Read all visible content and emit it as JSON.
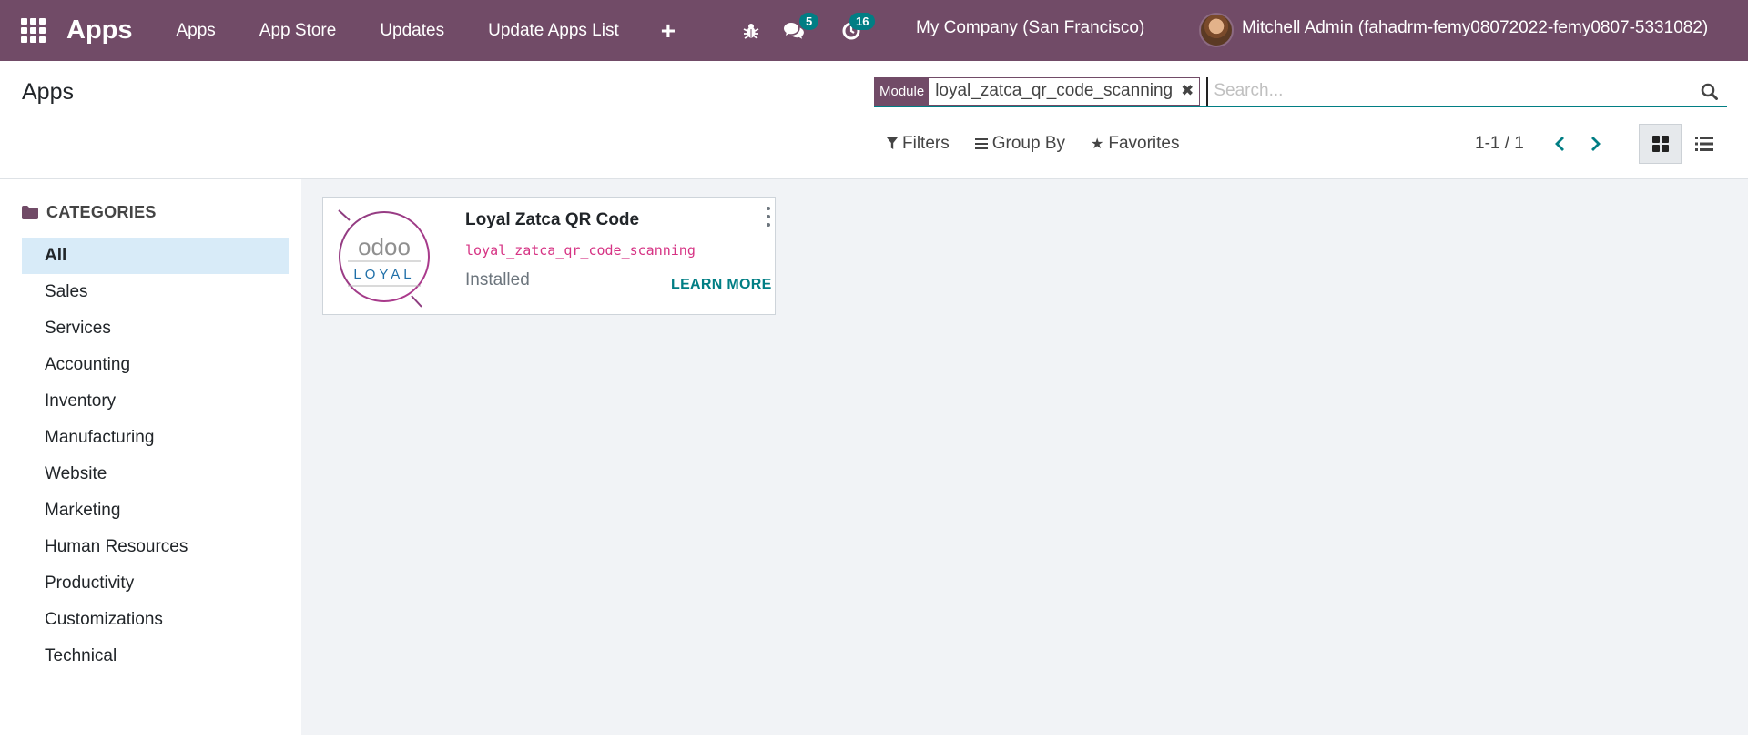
{
  "navbar": {
    "brand": "Apps",
    "menu": [
      "Apps",
      "App Store",
      "Updates",
      "Update Apps List"
    ],
    "plus_label": "+",
    "chat_count": "5",
    "activity_count": "16",
    "company": "My Company (San Francisco)",
    "user": "Mitchell Admin (fahadrm-femy08072022-femy0807-5331082)",
    "colors": {
      "brand": "#714B67",
      "accent": "#017E84"
    }
  },
  "control": {
    "breadcrumb": "Apps",
    "facet_label": "Module",
    "facet_value": "loyal_zatca_qr_code_scanning",
    "search_placeholder": "Search...",
    "filters": "Filters",
    "group_by": "Group By",
    "favorites": "Favorites",
    "pager": "1-1 / 1"
  },
  "sidebar": {
    "header": "CATEGORIES",
    "items": [
      "All",
      "Sales",
      "Services",
      "Accounting",
      "Inventory",
      "Manufacturing",
      "Website",
      "Marketing",
      "Human Resources",
      "Productivity",
      "Customizations",
      "Technical"
    ],
    "active": "All"
  },
  "card": {
    "title": "Loyal Zatca QR Code",
    "module": "loyal_zatca_qr_code_scanning",
    "status": "Installed",
    "learn_more": "LEARN MORE",
    "logo_text": "odoo",
    "logo_subtext": "LOYAL"
  }
}
